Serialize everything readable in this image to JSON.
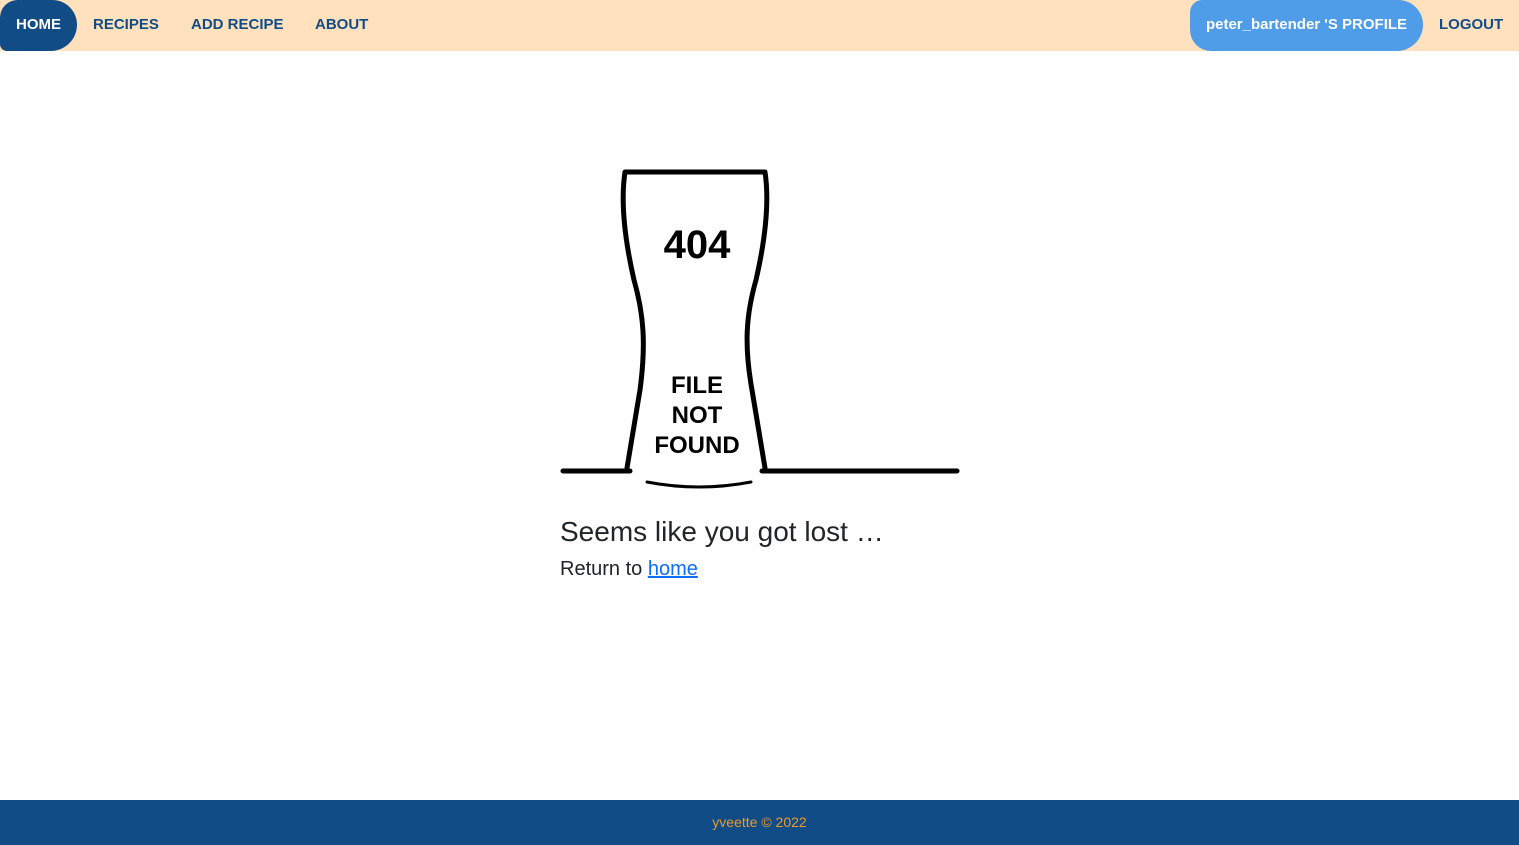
{
  "nav": {
    "home": "HOME",
    "recipes": "RECIPES",
    "add_recipe": "ADD RECIPE",
    "about": "ABOUT",
    "profile": "peter_bartender 'S PROFILE",
    "logout": "LOGOUT"
  },
  "error_graphic": {
    "code": "404",
    "message_lines": [
      "FILE",
      "NOT",
      "FOUND"
    ]
  },
  "main": {
    "lost_text": "Seems like you got lost …",
    "return_prefix": "Return to ",
    "home_link": "home"
  },
  "footer": {
    "text": "yveette © 2022"
  },
  "colors": {
    "navbar_bg": "#ffe1bd",
    "nav_text": "#124c87",
    "active_bg": "#124c87",
    "profile_bg": "#4f9ce8",
    "footer_bg": "#124c87",
    "footer_text": "#e89a2c",
    "link": "#0d6efd"
  }
}
